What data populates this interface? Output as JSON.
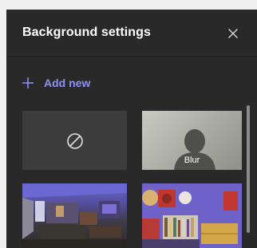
{
  "panel": {
    "title": "Background settings",
    "close_icon": "close-icon"
  },
  "add_new": {
    "label": "Add new",
    "icon": "plus-icon"
  },
  "backgrounds": [
    {
      "kind": "none",
      "icon": "no-background-icon"
    },
    {
      "kind": "blur",
      "label": "Blur"
    },
    {
      "kind": "image",
      "scene": "living-room"
    },
    {
      "kind": "image",
      "scene": "bookshelf-room"
    }
  ],
  "colors": {
    "panel_bg": "#292929",
    "accent": "#8f92f2",
    "tile_bg": "#3c3c3c"
  }
}
